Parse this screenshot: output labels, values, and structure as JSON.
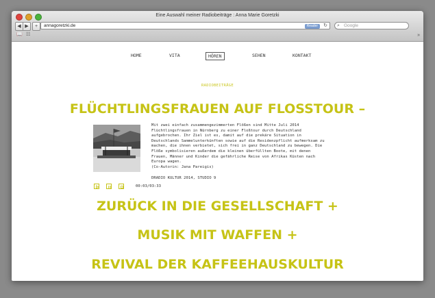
{
  "window": {
    "title": "Eine Auswahl meiner Radiobeiträge : Anna Marie Goretzki"
  },
  "toolbar": {
    "back_icon": "◀",
    "forward_icon": "▶",
    "add_icon": "+",
    "url": "annagoretzki.de",
    "reader_label": "Reader",
    "reload_icon": "↻",
    "search_placeholder": "Google",
    "overflow_icon": "»"
  },
  "bookmarks": {
    "book_icon": "📖",
    "grid_icon": "☷"
  },
  "site_nav": {
    "items": [
      {
        "label": "HOME"
      },
      {
        "label": "VITA"
      },
      {
        "label": "HÖREN"
      },
      {
        "label": "SEHEN"
      },
      {
        "label": "KONTAKT"
      }
    ],
    "active_index": 2
  },
  "section_label": "RADIOBEITRÄGE",
  "featured": {
    "title": "FLÜCHTLINGSFRAUEN AUF FLOSSTOUR –",
    "description": "Mit zwei einfach zusammengezimmerten Flößen sind Mitte Juli 2014\nFlüchtlingsfrauen in Nürnberg zu einer Floßtour durch Deutschland\naufgebrochen. Ihr Ziel ist es, damit auf die prekäre Situation in\nDeutschlands Sammelunterkünften sowie auf die Residenzpflicht aufmerksam zu\nmachen, die ihnen verbietet, sich frei in ganz Deutschland zu bewegen. Die\nFlöße symbolisieren außerdem die kleinen überfüllten Boote, mit denen\nFrauen, Männer und Kinder die gefährliche Reise von Afrikas Küsten nach\nEuropa wagen.\n(Co-Autorin: Jana Pareigis)",
    "source": "DRADIO KULTUR 2014, STUDIO 9",
    "player": {
      "play_icon": "▷",
      "pause_icon": "▯▯",
      "stop_icon": "▢",
      "time": "00:03/03:33"
    }
  },
  "items": [
    {
      "title": "ZURÜCK IN DIE GESELLSCHAFT +"
    },
    {
      "title": "MUSIK MIT WAFFEN +"
    },
    {
      "title": "REVIVAL DER KAFFEEHAUSKULTUR"
    }
  ],
  "colors": {
    "accent": "#c6c316",
    "background": "#8a8a8a"
  }
}
